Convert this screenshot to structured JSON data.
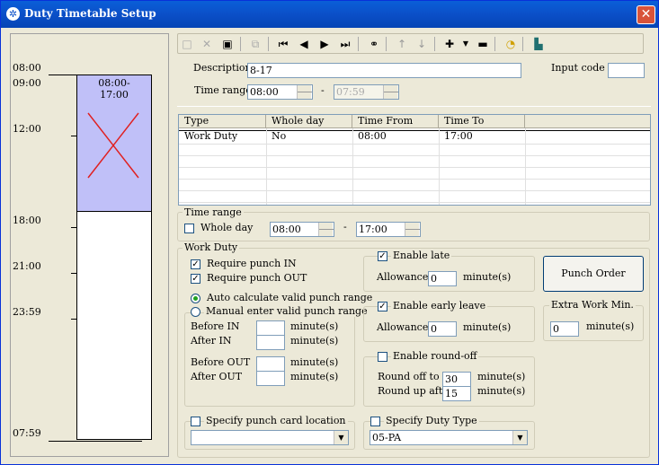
{
  "window": {
    "title": "Duty Timetable Setup"
  },
  "timeline": {
    "labels": [
      "08:00",
      "09:00",
      "12:00",
      "18:00",
      "21:00",
      "23:59",
      "07:59"
    ],
    "block_label": "08:00-\n17:00",
    "block_label_line1": "08:00-",
    "block_label_line2": "17:00"
  },
  "form": {
    "description_label": "Description",
    "description_value": "8-17",
    "input_code_label": "Input code :",
    "input_code_value": "",
    "time_range_label": "Time range",
    "time_from": "08:00",
    "time_to": "07:59",
    "dash": "-"
  },
  "table": {
    "headers": [
      "Type",
      "Whole day",
      "Time From",
      "Time To"
    ],
    "rows": [
      {
        "type": "Work Duty",
        "whole_day": "No",
        "time_from": "08:00",
        "time_to": "17:00"
      }
    ]
  },
  "time_range_group": {
    "title": "Time range",
    "whole_day_label": "Whole day",
    "from": "08:00",
    "to": "17:00",
    "dash": "-"
  },
  "work_duty": {
    "title": "Work Duty",
    "require_in": "Require punch IN",
    "require_out": "Require punch OUT",
    "auto_calc": "Auto calculate valid punch range",
    "manual_enter": "Manual enter valid punch range",
    "before_in": "Before IN",
    "after_in": "After IN",
    "before_out": "Before OUT",
    "after_out": "After OUT",
    "minutes": "minute(s)",
    "enable_late": "Enable late",
    "late_allowance_label": "Allowance",
    "late_allowance": "0",
    "enable_early": "Enable early leave",
    "early_allowance_label": "Allowance",
    "early_allowance": "0",
    "enable_roundoff": "Enable round-off",
    "round_off_label": "Round off to",
    "round_off_value": "30",
    "round_up_label": "Round up after",
    "round_up_value": "15",
    "punch_order_button": "Punch Order",
    "extra_work_title": "Extra Work Min.",
    "extra_work_value": "0",
    "specify_location": "Specify punch card location",
    "location_value": "",
    "specify_duty_type": "Specify Duty Type",
    "duty_type_value": "05-PA"
  },
  "icons": {
    "new": "new-icon",
    "delete": "delete-icon",
    "save": "save-icon",
    "copy": "copy-icon",
    "first": "first-icon",
    "prev": "prev-icon",
    "next": "next-icon",
    "last": "last-icon",
    "find": "binoculars-icon",
    "up": "arrow-up-icon",
    "down": "arrow-down-icon",
    "add": "plus-icon",
    "remove": "minus-icon",
    "clock": "clock-icon",
    "exit": "exit-icon"
  }
}
